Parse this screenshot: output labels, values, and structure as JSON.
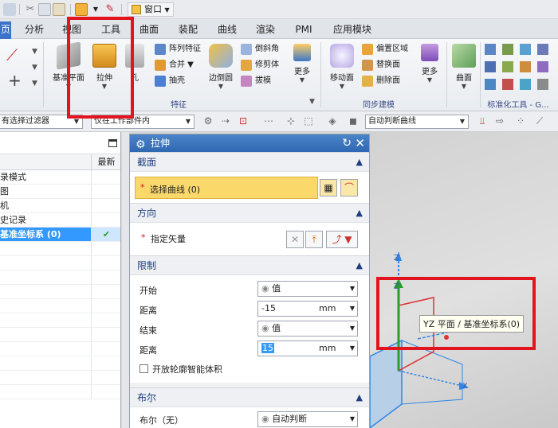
{
  "window_menu": {
    "label": "窗口"
  },
  "tabs": [
    "页",
    "分析",
    "视图",
    "工具",
    "曲面",
    "装配",
    "曲线",
    "渲染",
    "PMI",
    "应用模块"
  ],
  "ribbon": {
    "datum_plane": "基准平面",
    "extrude": "拉伸",
    "hole_partial": "孔",
    "pattern_feature": "阵列特征",
    "unite": "合并",
    "shell": "抽壳",
    "edge_blend": "边倒圆",
    "chamfer": "倒斜角",
    "trim_body": "修剪体",
    "draft": "拔模",
    "more1": "更多",
    "move_face": "移动面",
    "offset_region": "偏置区域",
    "replace_face": "替换面",
    "delete_face": "删除面",
    "more2": "更多",
    "surface": "曲面",
    "group_feature": "特征",
    "group_sync": "同步建模",
    "group_std": "标准化工具 - G..."
  },
  "filter_bar": {
    "type_filter": "有选择过滤器",
    "scope": "仅在工作部件内",
    "curve_rule": "自动判断曲线"
  },
  "navigator": {
    "col_latest": "最新",
    "rows": [
      {
        "label": "录模式",
        "latest": ""
      },
      {
        "label": "图",
        "latest": ""
      },
      {
        "label": "机",
        "latest": ""
      },
      {
        "label": "史记录",
        "latest": ""
      },
      {
        "label": "基准坐标系 (0)",
        "latest": "✔"
      }
    ]
  },
  "dialog": {
    "title": "拉伸",
    "section_section": "截面",
    "select_curve": "选择曲线 (0)",
    "section_direction": "方向",
    "specify_vector": "指定矢量",
    "section_limits": "限制",
    "start_label": "开始",
    "start_value": "值",
    "distance1_label": "距离",
    "distance1_value": "-15",
    "distance1_unit": "mm",
    "end_label": "结束",
    "end_value": "值",
    "distance2_label": "距离",
    "distance2_value": "15",
    "distance2_unit": "mm",
    "open_profile": "开放轮廓智能体积",
    "section_boolean": "布尔",
    "boolean_label": "布尔（无）",
    "boolean_value": "自动判断"
  },
  "viewport": {
    "axis_z1": "Z",
    "axis_z2": "Z",
    "axis_x": "X",
    "tooltip": "YZ 平面 / 基准坐标系(0)"
  },
  "colors": {
    "accent": "#3a73c8",
    "highlight": "#e2141d",
    "selection": "#3399ff",
    "required_field": "#fbd86a"
  }
}
